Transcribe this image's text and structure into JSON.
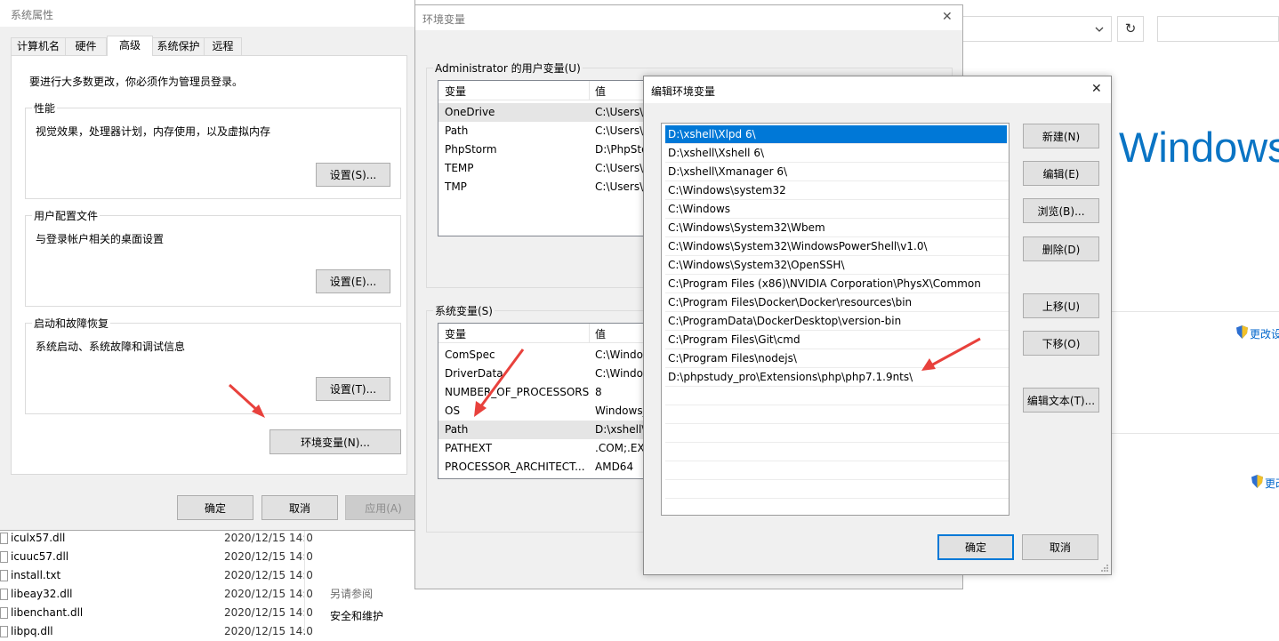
{
  "explorer": {
    "refresh_icon": "↻",
    "dropdown_icon": "chevron-down",
    "windows_logo_text": "Windows",
    "change_settings_1": "更改设",
    "change_settings_2": "更改",
    "see_also": "另请参阅",
    "security_maintenance": "安全和维护",
    "files": [
      {
        "name": "iculx57.dll",
        "date": "2020/12/15 14:0"
      },
      {
        "name": "icuuc57.dll",
        "date": "2020/12/15 14:0"
      },
      {
        "name": "install.txt",
        "date": "2020/12/15 14:0"
      },
      {
        "name": "libeay32.dll",
        "date": "2020/12/15 14:0"
      },
      {
        "name": "libenchant.dll",
        "date": "2020/12/15 14:0"
      },
      {
        "name": "libpq.dll",
        "date": "2020/12/15 14:0"
      }
    ]
  },
  "sysprops": {
    "title": "系统属性",
    "tabs": [
      "计算机名",
      "硬件",
      "高级",
      "系统保护",
      "远程"
    ],
    "admin_note": "要进行大多数更改，你必须作为管理员登录。",
    "performance": {
      "title": "性能",
      "desc": "视觉效果，处理器计划，内存使用，以及虚拟内存",
      "button": "设置(S)..."
    },
    "user_profiles": {
      "title": "用户配置文件",
      "desc": "与登录帐户相关的桌面设置",
      "button": "设置(E)..."
    },
    "startup": {
      "title": "启动和故障恢复",
      "desc": "系统启动、系统故障和调试信息",
      "button": "设置(T)..."
    },
    "env_button": "环境变量(N)...",
    "ok": "确定",
    "cancel": "取消",
    "apply": "应用(A)"
  },
  "envvars": {
    "title": "环境变量",
    "close_icon": "✕",
    "user_group": "Administrator 的用户变量(U)",
    "sys_group": "系统变量(S)",
    "col_var": "变量",
    "col_val": "值",
    "user_vars": [
      {
        "name": "OneDrive",
        "value": "C:\\Users\\A"
      },
      {
        "name": "Path",
        "value": "C:\\Users\\A"
      },
      {
        "name": "PhpStorm",
        "value": "D:\\PhpSto"
      },
      {
        "name": "TEMP",
        "value": "C:\\Users\\A"
      },
      {
        "name": "TMP",
        "value": "C:\\Users\\A"
      }
    ],
    "sys_vars": [
      {
        "name": "ComSpec",
        "value": "C:\\Windo"
      },
      {
        "name": "DriverData",
        "value": "C:\\Windo"
      },
      {
        "name": "NUMBER_OF_PROCESSORS",
        "value": "8"
      },
      {
        "name": "OS",
        "value": "Windows_"
      },
      {
        "name": "Path",
        "value": "D:\\xshell\\"
      },
      {
        "name": "PATHEXT",
        "value": ".COM;.EX"
      },
      {
        "name": "PROCESSOR_ARCHITECT...",
        "value": "AMD64"
      }
    ]
  },
  "editenv": {
    "title": "编辑环境变量",
    "close_icon": "✕",
    "entries": [
      "D:\\xshell\\Xlpd 6\\",
      "D:\\xshell\\Xshell 6\\",
      "D:\\xshell\\Xmanager 6\\",
      "C:\\Windows\\system32",
      "C:\\Windows",
      "C:\\Windows\\System32\\Wbem",
      "C:\\Windows\\System32\\WindowsPowerShell\\v1.0\\",
      "C:\\Windows\\System32\\OpenSSH\\",
      "C:\\Program Files (x86)\\NVIDIA Corporation\\PhysX\\Common",
      "C:\\Program Files\\Docker\\Docker\\resources\\bin",
      "C:\\ProgramData\\DockerDesktop\\version-bin",
      "C:\\Program Files\\Git\\cmd",
      "C:\\Program Files\\nodejs\\",
      "D:\\phpstudy_pro\\Extensions\\php\\php7.1.9nts\\"
    ],
    "buttons": {
      "new": "新建(N)",
      "edit": "编辑(E)",
      "browse": "浏览(B)...",
      "delete": "删除(D)",
      "up": "上移(U)",
      "down": "下移(O)",
      "edit_text": "编辑文本(T)...",
      "ok": "确定",
      "cancel": "取消"
    }
  },
  "colors": {
    "accent": "#0078d7",
    "arrow": "#e8413c",
    "dialog_bg": "#f0f0f0"
  }
}
